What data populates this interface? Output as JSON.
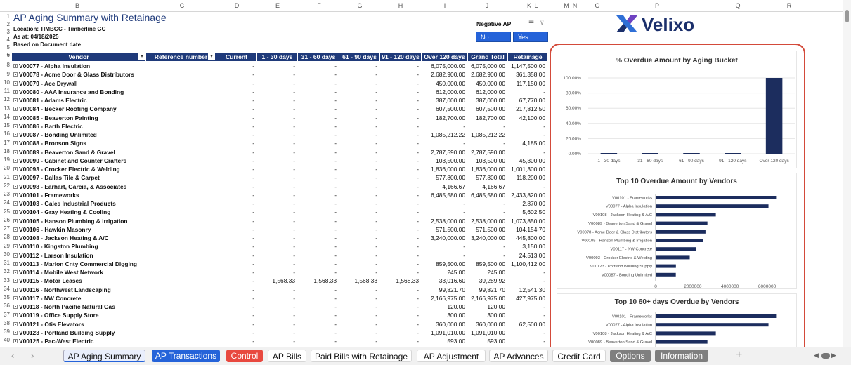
{
  "report": {
    "title": "AP Aging Summary with Retainage",
    "location": "Location: TIMBGC - Timberline GC",
    "as_at": "As at: 04/18/2025",
    "basis": "Based on Document date"
  },
  "slicer": {
    "title": "Negative AP",
    "options": [
      "No",
      "Yes"
    ]
  },
  "brand": {
    "name": "Velixo",
    "colors": {
      "blue": "#2f6fd6",
      "purple": "#6f42c1",
      "navy": "#1b2f6b"
    }
  },
  "columns": {
    "letters": [
      "B",
      "C",
      "D",
      "E",
      "F",
      "G",
      "H",
      "I",
      "J",
      "K",
      "L",
      "M",
      "N",
      "O",
      "P",
      "Q",
      "R"
    ]
  },
  "table": {
    "headers": [
      "Vendor",
      "Reference number",
      "Current",
      "1 - 30 days",
      "31 - 60 days",
      "61 - 90 days",
      "91 - 120 days",
      "Over 120 days",
      "Grand Total",
      "Retainage"
    ],
    "rows": [
      [
        "V00077 - Alpha Insulation",
        "",
        "-",
        "-",
        "-",
        "-",
        "-",
        "6,075,000.00",
        "6,075,000.00",
        "1,147,500.00"
      ],
      [
        "V00078 - Acme Door & Glass Distributors",
        "",
        "-",
        "-",
        "-",
        "-",
        "-",
        "2,682,900.00",
        "2,682,900.00",
        "361,358.00"
      ],
      [
        "V00079 - Ace Drywall",
        "",
        "-",
        "-",
        "-",
        "-",
        "-",
        "450,000.00",
        "450,000.00",
        "117,150.00"
      ],
      [
        "V00080 - AAA Insurance and Bonding",
        "",
        "-",
        "-",
        "-",
        "-",
        "-",
        "612,000.00",
        "612,000.00",
        "-"
      ],
      [
        "V00081 - Adams Electric",
        "",
        "-",
        "-",
        "-",
        "-",
        "-",
        "387,000.00",
        "387,000.00",
        "67,770.00"
      ],
      [
        "V00084 - Becker Roofing Company",
        "",
        "-",
        "-",
        "-",
        "-",
        "-",
        "607,500.00",
        "607,500.00",
        "217,812.50"
      ],
      [
        "V00085 - Beaverton Painting",
        "",
        "-",
        "-",
        "-",
        "-",
        "-",
        "182,700.00",
        "182,700.00",
        "42,100.00"
      ],
      [
        "V00086 - Barth Electric",
        "",
        "-",
        "-",
        "-",
        "-",
        "-",
        "-",
        "-",
        "-"
      ],
      [
        "V00087 - Bonding Unlimited",
        "",
        "-",
        "-",
        "-",
        "-",
        "-",
        "1,085,212.22",
        "1,085,212.22",
        "-"
      ],
      [
        "V00088 - Bronson Signs",
        "",
        "-",
        "-",
        "-",
        "-",
        "-",
        "-",
        "-",
        "4,185.00"
      ],
      [
        "V00089 - Beaverton Sand & Gravel",
        "",
        "-",
        "-",
        "-",
        "-",
        "-",
        "2,787,590.00",
        "2,787,590.00",
        "-"
      ],
      [
        "V00090 - Cabinet and Counter Crafters",
        "",
        "-",
        "-",
        "-",
        "-",
        "-",
        "103,500.00",
        "103,500.00",
        "45,300.00"
      ],
      [
        "V00093 - Crocker Electric & Welding",
        "",
        "-",
        "-",
        "-",
        "-",
        "-",
        "1,836,000.00",
        "1,836,000.00",
        "1,001,300.00"
      ],
      [
        "V00097 - Dallas Tile & Carpet",
        "",
        "-",
        "-",
        "-",
        "-",
        "-",
        "577,800.00",
        "577,800.00",
        "118,200.00"
      ],
      [
        "V00098 - Earhart, Garcia, & Associates",
        "",
        "-",
        "-",
        "-",
        "-",
        "-",
        "4,166.67",
        "4,166.67",
        "-"
      ],
      [
        "V00101 - Frameworks",
        "",
        "-",
        "-",
        "-",
        "-",
        "-",
        "6,485,580.00",
        "6,485,580.00",
        "2,433,820.00"
      ],
      [
        "V00103 - Gales Industrial Products",
        "",
        "-",
        "-",
        "-",
        "-",
        "-",
        "-",
        "-",
        "2,870.00"
      ],
      [
        "V00104 - Gray Heating & Cooling",
        "",
        "-",
        "-",
        "-",
        "-",
        "-",
        "-",
        "-",
        "5,602.50"
      ],
      [
        "V00105 - Hanson Plumbing & Irrigation",
        "",
        "-",
        "-",
        "-",
        "-",
        "-",
        "2,538,000.00",
        "2,538,000.00",
        "1,073,850.00"
      ],
      [
        "V00106 - Hawkin Masonry",
        "",
        "-",
        "-",
        "-",
        "-",
        "-",
        "571,500.00",
        "571,500.00",
        "104,154.70"
      ],
      [
        "V00108 - Jackson Heating & A/C",
        "",
        "-",
        "-",
        "-",
        "-",
        "-",
        "3,240,000.00",
        "3,240,000.00",
        "445,800.00"
      ],
      [
        "V00110 - Kingston Plumbing",
        "",
        "-",
        "-",
        "-",
        "-",
        "-",
        "-",
        "-",
        "3,150.00"
      ],
      [
        "V00112 - Larson Insulation",
        "",
        "-",
        "-",
        "-",
        "-",
        "-",
        "-",
        "-",
        "24,513.00"
      ],
      [
        "V00113 - Marion Cnty Commercial Digging",
        "",
        "-",
        "-",
        "-",
        "-",
        "-",
        "859,500.00",
        "859,500.00",
        "1,100,412.00"
      ],
      [
        "V00114 - Mobile West Network",
        "",
        "-",
        "-",
        "-",
        "-",
        "-",
        "245.00",
        "245.00",
        "-"
      ],
      [
        "V00115 - Motor Leases",
        "",
        "-",
        "1,568.33",
        "1,568.33",
        "1,568.33",
        "1,568.33",
        "33,016.60",
        "39,289.92",
        "-"
      ],
      [
        "V00116 - Northwest Landscaping",
        "",
        "-",
        "-",
        "-",
        "-",
        "-",
        "99,821.70",
        "99,821.70",
        "12,541.30"
      ],
      [
        "V00117 - NW Concrete",
        "",
        "-",
        "-",
        "-",
        "-",
        "-",
        "2,166,975.00",
        "2,166,975.00",
        "427,975.00"
      ],
      [
        "V00118 - North Pacific Natural Gas",
        "",
        "-",
        "-",
        "-",
        "-",
        "-",
        "120.00",
        "120.00",
        "-"
      ],
      [
        "V00119 - Office Supply Store",
        "",
        "-",
        "-",
        "-",
        "-",
        "-",
        "300.00",
        "300.00",
        "-"
      ],
      [
        "V00121 - Otis Elevators",
        "",
        "-",
        "-",
        "-",
        "-",
        "-",
        "360,000.00",
        "360,000.00",
        "62,500.00"
      ],
      [
        "V00123 - Portland Building Supply",
        "",
        "-",
        "-",
        "-",
        "-",
        "-",
        "1,091,010.00",
        "1,091,010.00",
        "-"
      ],
      [
        "V00125 - Pac-West Electric",
        "",
        "-",
        "-",
        "-",
        "-",
        "-",
        "593.00",
        "593.00",
        "-"
      ]
    ]
  },
  "chart_data": [
    {
      "type": "bar",
      "title": "% Overdue Amount by Aging Bucket",
      "categories": [
        "1 - 30 days",
        "31 - 60 days",
        "61 - 90 days",
        "91 - 120 days",
        "Over 120 days"
      ],
      "values": [
        0.0,
        0.0,
        0.0,
        0.0,
        100.0
      ],
      "yticks": [
        "0.00%",
        "20.00%",
        "40.00%",
        "60.00%",
        "80.00%",
        "100.00%"
      ],
      "ylim": [
        0,
        100
      ]
    },
    {
      "type": "bar",
      "orientation": "horizontal",
      "title": "Top 10 Overdue Amount by Vendors",
      "categories": [
        "V00101 - Frameworks",
        "V00077 - Alpha Insulation",
        "V00108 - Jackson Heating & A/C",
        "V00089 - Beaverton Sand & Gravel",
        "V00078 - Acme Door & Glass Distributors",
        "V00105 - Hanson Plumbing & Irrigation",
        "V00117 - NW Concrete",
        "V00093 - Crocker Electric & Welding",
        "V00123 - Portland Building Supply",
        "V00087 - Bonding Unlimited"
      ],
      "values": [
        6485580,
        6075000,
        3240000,
        2787590,
        2682900,
        2538000,
        2166975,
        1836000,
        1091010,
        1085212
      ],
      "xticks": [
        "0",
        "2000000",
        "4000000",
        "6000000"
      ],
      "xlim": [
        0,
        7000000
      ]
    },
    {
      "type": "bar",
      "orientation": "horizontal",
      "title": "Top 10 60+ days Overdue by Vendors",
      "categories": [
        "V00101 - Frameworks",
        "V00077 - Alpha Insulation",
        "V00108 - Jackson Heating & A/C",
        "V00089 - Beaverton Sand & Gravel"
      ],
      "values": [
        6485580,
        6075000,
        3240000,
        2787590
      ],
      "xlim": [
        0,
        7000000
      ]
    }
  ],
  "sheet_tabs": [
    {
      "label": "AP Aging Summary",
      "active": true,
      "color": "#dfe8ff"
    },
    {
      "label": "AP Transactions",
      "color": "#2563d9"
    },
    {
      "label": "Control",
      "color": "#e8493f"
    },
    {
      "label": "AP Bills",
      "color": ""
    },
    {
      "label": "Paid Bills with Retainage",
      "color": ""
    },
    {
      "label": "AP Adjustment",
      "color": ""
    },
    {
      "label": "AP Advances",
      "color": ""
    },
    {
      "label": "Credit Card",
      "color": ""
    },
    {
      "label": "Options",
      "color": "#7f7f7f"
    },
    {
      "label": "Information",
      "color": "#7f7f7f"
    }
  ],
  "add_sheet": "+"
}
